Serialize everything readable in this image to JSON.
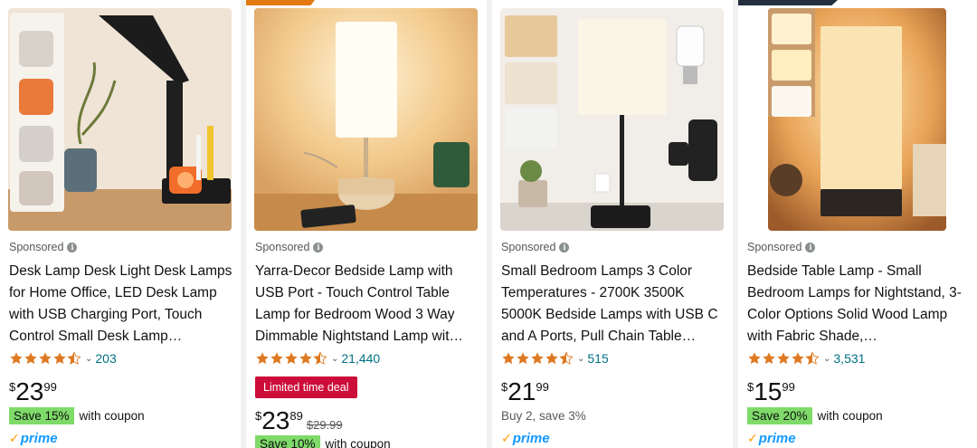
{
  "products": [
    {
      "sponsored": "Sponsored",
      "title": "Desk Lamp Desk Light Desk Lamps for Home Office, LED Desk Lamp with USB Charging Port, Touch Control Small Desk Lamp…",
      "rating": 4.5,
      "reviews": "203",
      "price_symbol": "$",
      "price_whole": "23",
      "price_fraction": "99",
      "coupon_badge": "Save 15%",
      "coupon_text": "with coupon",
      "prime": "prime"
    },
    {
      "sponsored": "Sponsored",
      "title": "Yarra-Decor Bedside Lamp with USB Port - Touch Control Table Lamp for Bedroom Wood 3 Way Dimmable Nightstand Lamp wit…",
      "rating": 4.5,
      "reviews": "21,440",
      "deal_badge": "Limited time deal",
      "price_symbol": "$",
      "price_whole": "23",
      "price_fraction": "89",
      "list_price": "$29.99",
      "coupon_badge": "Save 10%",
      "coupon_text": "with coupon"
    },
    {
      "sponsored": "Sponsored",
      "title": "Small Bedroom Lamps 3 Color Temperatures - 2700K 3500K 5000K Bedside Lamps with USB C and A Ports, Pull Chain Table…",
      "rating": 4.5,
      "reviews": "515",
      "price_symbol": "$",
      "price_whole": "21",
      "price_fraction": "99",
      "offer_text": "Buy 2, save 3%",
      "prime": "prime"
    },
    {
      "sponsored": "Sponsored",
      "title": "Bedside Table Lamp - Small Bedroom Lamps for Nightstand, 3-Color Options Solid Wood Lamp with Fabric Shade,…",
      "rating": 4.5,
      "reviews": "3,531",
      "price_symbol": "$",
      "price_whole": "15",
      "price_fraction": "99",
      "coupon_badge": "Save 20%",
      "coupon_text": "with coupon",
      "prime": "prime"
    }
  ],
  "icons": {
    "info": "info-icon",
    "star": "star-icon",
    "chevron": "chevron-down-icon",
    "prime_check": "prime-check-icon"
  },
  "colors": {
    "link": "#007185",
    "star": "#de7921",
    "deal": "#cc0c39",
    "coupon": "#7fda69",
    "prime": "#1399ff",
    "ribbon_orange": "#e47911",
    "ribbon_dark": "#232f3e"
  }
}
